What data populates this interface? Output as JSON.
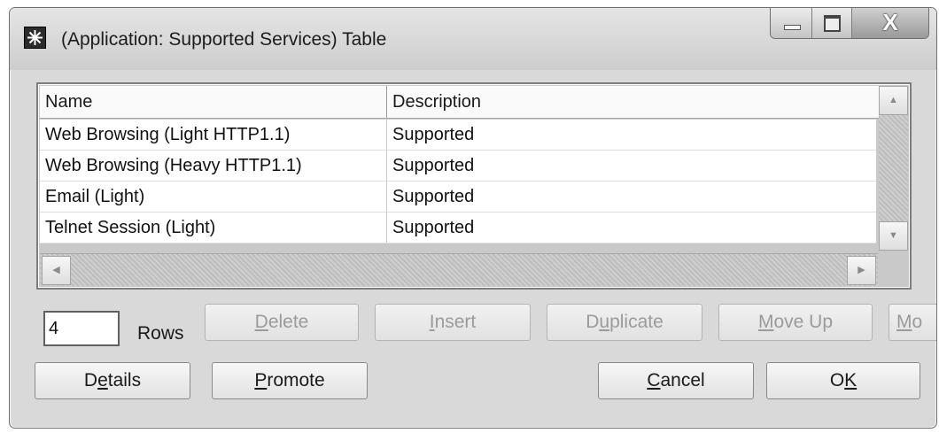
{
  "window": {
    "title": "(Application: Supported Services) Table",
    "controls": {
      "minimize_icon": "minimize-icon",
      "maximize_icon": "maximize-icon",
      "close_glyph": "X"
    }
  },
  "table": {
    "columns": [
      "Name",
      "Description"
    ],
    "rows": [
      {
        "name": "Web Browsing (Light HTTP1.1)",
        "description": "Supported"
      },
      {
        "name": "Web Browsing (Heavy HTTP1.1)",
        "description": "Supported"
      },
      {
        "name": "Email (Light)",
        "description": "Supported"
      },
      {
        "name": "Telnet Session (Light)",
        "description": "Supported"
      }
    ]
  },
  "rows_field": {
    "value": "4",
    "label": "Rows"
  },
  "action_buttons": {
    "delete": {
      "pre": "",
      "key": "D",
      "post": "elete"
    },
    "insert": {
      "pre": "",
      "key": "I",
      "post": "nsert"
    },
    "duplicate": {
      "pre": "D",
      "key": "u",
      "post": "plicate"
    },
    "move_up": {
      "pre": "",
      "key": "M",
      "post": "ove Up"
    },
    "move_down_partial": {
      "pre": "",
      "key": "M",
      "post": "o"
    }
  },
  "bottom_buttons": {
    "details": {
      "pre": "D",
      "key": "e",
      "post": "tails"
    },
    "promote": {
      "pre": "",
      "key": "P",
      "post": "romote"
    },
    "cancel": {
      "pre": "",
      "key": "C",
      "post": "ancel"
    },
    "ok": {
      "pre": "O",
      "key": "K",
      "post": ""
    }
  },
  "colors": {
    "window_bg": "#d9d9d9",
    "disabled_text": "#9b9b9b",
    "table_bg": "#c9c9c9"
  }
}
